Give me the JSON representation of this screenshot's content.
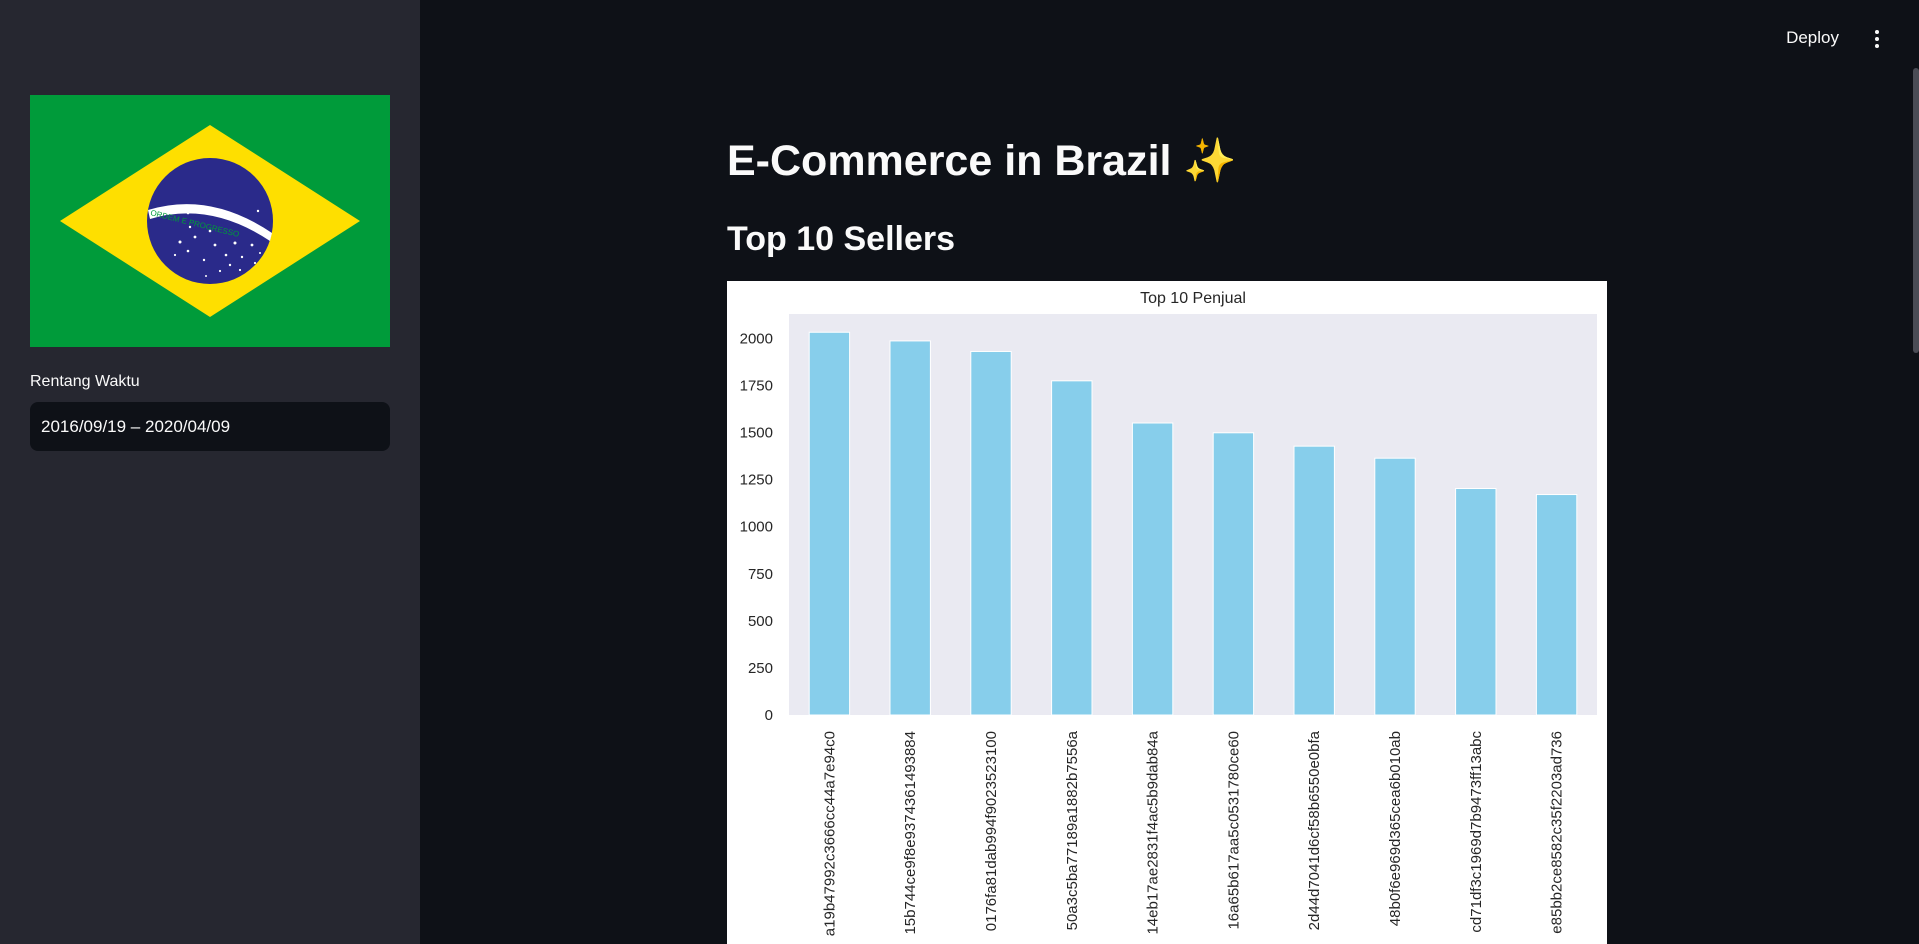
{
  "sidebar": {
    "flag_motto": "ORDEM E PROGRESSO",
    "date_label": "Rentang Waktu",
    "date_value": "2016/09/19 – 2020/04/09"
  },
  "header": {
    "deploy_label": "Deploy",
    "menu_icon": "more-vertical-icon"
  },
  "main": {
    "title": "E-Commerce in Brazil ✨",
    "section_title": "Top 10 Sellers"
  },
  "colors": {
    "bar": "#87ceeb",
    "plot_bg": "#eaeaf2",
    "sidebar_bg": "#262730",
    "main_bg": "#0e1117"
  },
  "chart_data": {
    "type": "bar",
    "title": "Top 10 Penjual",
    "xlabel": "",
    "ylabel": "",
    "ylim": [
      0,
      2130
    ],
    "yticks": [
      0,
      250,
      500,
      750,
      1000,
      1250,
      1500,
      1750,
      2000
    ],
    "grid": false,
    "categories": [
      "a19b47992c3666cc44a7e94c0",
      "15b744ce9f8e9374361493884",
      "0176fa81dab994f9023523100",
      "50a3c5ba77189a1882b7556a",
      "14eb17ae2831f4ac5b9dab84a",
      "16a65b617aa5c0531780ce60",
      "2d44d7041d6cf58b6550e0bfa",
      "48b0f6e969d365cea6b010ab",
      "cd71df3c1969d7b9473ff13abc",
      "e85bb2ce8582c35f2203ad736"
    ],
    "values": [
      2033,
      1987,
      1931,
      1775,
      1551,
      1499,
      1428,
      1364,
      1203,
      1171
    ]
  }
}
